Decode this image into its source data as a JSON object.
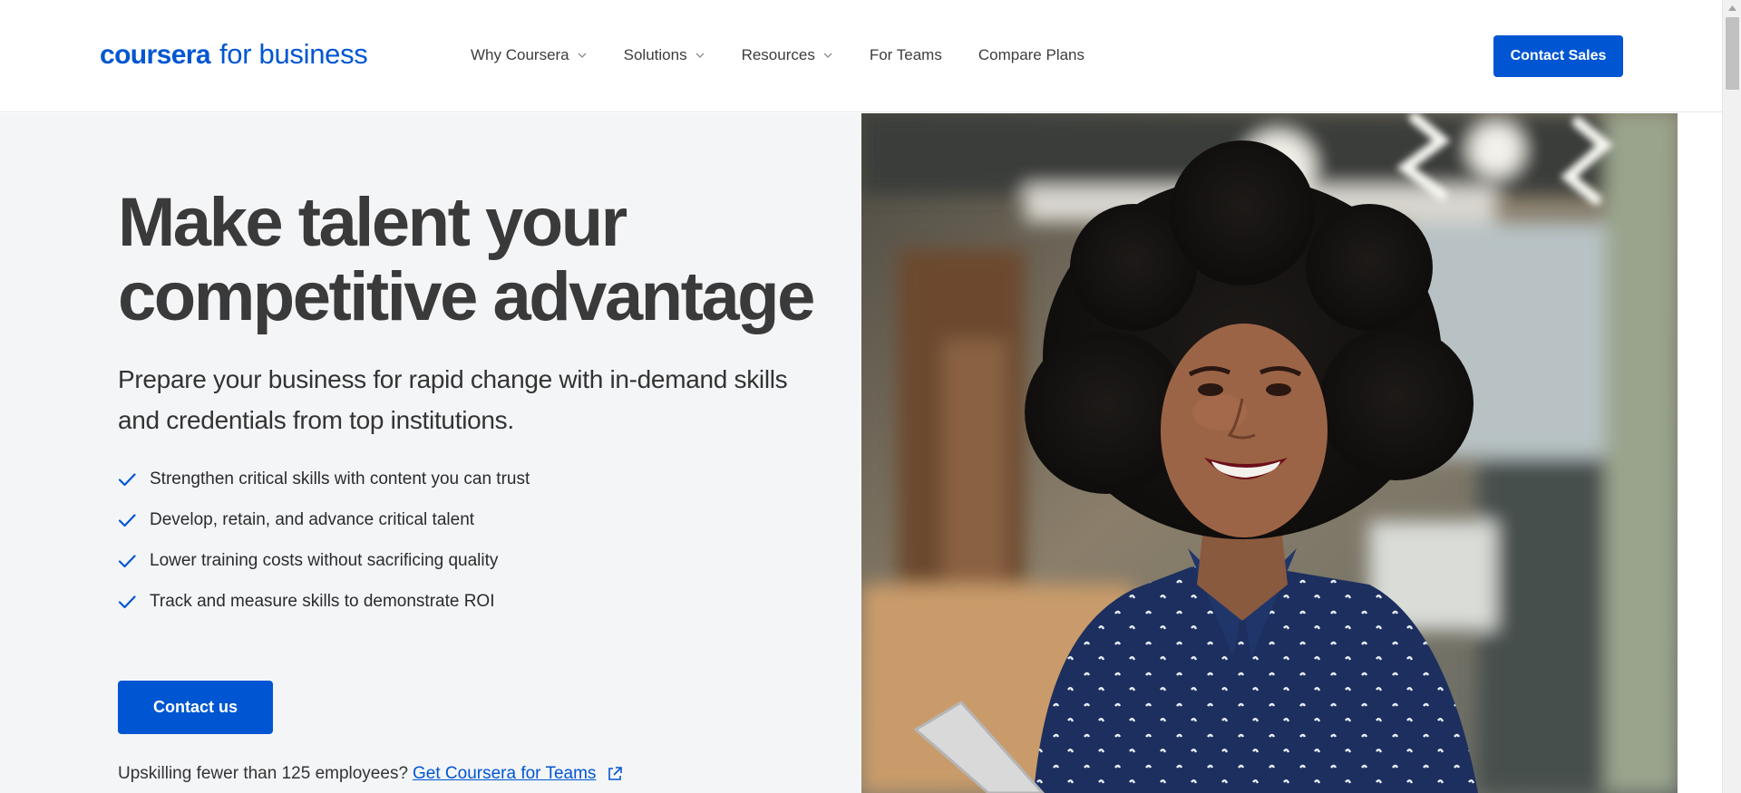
{
  "header": {
    "logo": {
      "brand": "coursera",
      "suffix": "for business"
    },
    "nav": [
      {
        "label": "Why Coursera",
        "has_dropdown": true
      },
      {
        "label": "Solutions",
        "has_dropdown": true
      },
      {
        "label": "Resources",
        "has_dropdown": true
      },
      {
        "label": "For Teams",
        "has_dropdown": false
      },
      {
        "label": "Compare Plans",
        "has_dropdown": false
      }
    ],
    "cta_label": "Contact Sales"
  },
  "hero": {
    "headline": "Make talent your competitive advantage",
    "subhead": "Prepare your business for rapid change with in-demand skills and credentials from top institutions.",
    "bullets": [
      "Strengthen critical skills with content you can trust",
      "Develop, retain, and advance critical talent",
      "Lower training costs without sacrificing quality",
      "Track and measure skills to demonstrate ROI"
    ],
    "cta_label": "Contact us",
    "teams_prompt": "Upskilling fewer than 125 employees?",
    "teams_link": "Get Coursera for Teams"
  },
  "icons": {
    "nav_dropdown": "chevron-down-icon",
    "bullet": "check-icon",
    "teams_link": "external-link-icon",
    "scrollbar": "scroll-up-arrow-icon"
  },
  "colors": {
    "brand_blue": "#0056d2",
    "hero_background": "#f4f5f7",
    "headline_text": "#3a3a3a"
  }
}
